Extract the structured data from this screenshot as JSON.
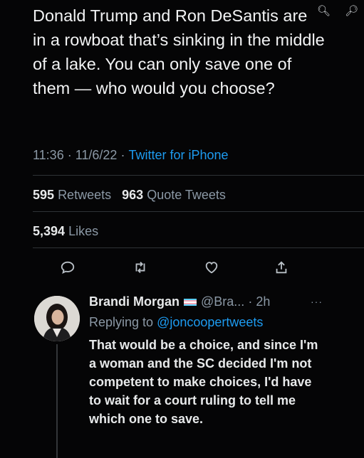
{
  "zoom": {
    "in_icon": "zoom-in-icon",
    "out_icon": "zoom-out-icon"
  },
  "tweet": {
    "text": "Donald Trump and Ron DeSantis are in a rowboat that’s sinking in the middle of a lake. You can only save one of them — who would you choose?",
    "time": "11:36",
    "date": "11/6/22",
    "source": "Twitter for iPhone",
    "retweets_count": "595",
    "retweets_label": "Retweets",
    "quote_count": "963",
    "quote_label": "Quote Tweets",
    "likes_count": "5,394",
    "likes_label": "Likes"
  },
  "actions": [
    "reply-icon",
    "retweet-icon",
    "like-icon",
    "share-icon"
  ],
  "reply": {
    "name": "Brandi Morgan",
    "handle": "@Bra...",
    "time": "2h",
    "replying_prefix": "Replying to",
    "replying_to": "@joncoopertweets",
    "text": "That would be a choice, and since I'm a woman and the SC decided I'm not competent to make choices, I'd have to wait for a court ruling to tell me which one to save.",
    "more": "···"
  },
  "colors": {
    "background": "#050506",
    "link": "#1d9bf0",
    "muted": "#8b98a5"
  }
}
